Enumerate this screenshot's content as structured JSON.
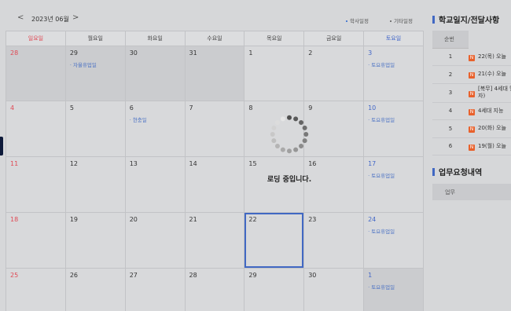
{
  "calendar": {
    "nav_prev": "<",
    "nav_next": ">",
    "month": "2023년 06월",
    "legend_school": "학사일정",
    "legend_other": "기타일정",
    "weekdays": [
      "일요일",
      "월요일",
      "화요일",
      "수요일",
      "목요일",
      "금요일",
      "토요일"
    ],
    "weeks": [
      [
        {
          "day": "28",
          "events": []
        },
        {
          "day": "29",
          "events": [
            "자율휴업일"
          ]
        },
        {
          "day": "30",
          "events": []
        },
        {
          "day": "31",
          "events": []
        },
        {
          "day": "1",
          "events": []
        },
        {
          "day": "2",
          "events": []
        },
        {
          "day": "3",
          "events": [
            "토요휴업일"
          ]
        }
      ],
      [
        {
          "day": "4",
          "events": []
        },
        {
          "day": "5",
          "events": []
        },
        {
          "day": "6",
          "events": [
            "현충일"
          ]
        },
        {
          "day": "7",
          "events": []
        },
        {
          "day": "8",
          "events": []
        },
        {
          "day": "9",
          "events": []
        },
        {
          "day": "10",
          "events": [
            "토요휴업일"
          ]
        }
      ],
      [
        {
          "day": "11",
          "events": []
        },
        {
          "day": "12",
          "events": []
        },
        {
          "day": "13",
          "events": []
        },
        {
          "day": "14",
          "events": []
        },
        {
          "day": "15",
          "events": []
        },
        {
          "day": "16",
          "events": []
        },
        {
          "day": "17",
          "events": [
            "토요휴업일"
          ]
        }
      ],
      [
        {
          "day": "18",
          "events": []
        },
        {
          "day": "19",
          "events": []
        },
        {
          "day": "20",
          "events": []
        },
        {
          "day": "21",
          "events": []
        },
        {
          "day": "22",
          "events": []
        },
        {
          "day": "23",
          "events": []
        },
        {
          "day": "24",
          "events": [
            "토요휴업일"
          ]
        }
      ],
      [
        {
          "day": "25",
          "events": []
        },
        {
          "day": "26",
          "events": []
        },
        {
          "day": "27",
          "events": []
        },
        {
          "day": "28",
          "events": []
        },
        {
          "day": "29",
          "events": []
        },
        {
          "day": "30",
          "events": []
        },
        {
          "day": "1",
          "events": [
            "토요휴업일"
          ]
        }
      ]
    ]
  },
  "loading": {
    "text": "로딩 중입니다."
  },
  "notice": {
    "title": "학교일지/전달사항",
    "col_no": "순번",
    "rows": [
      {
        "no": "1",
        "badge": "N",
        "text": "22(목) 오늘"
      },
      {
        "no": "2",
        "badge": "N",
        "text": "21(수) 오늘"
      },
      {
        "no": "3",
        "badge": "N",
        "text": "[복무] 4세대 당자)"
      },
      {
        "no": "4",
        "badge": "N",
        "text": "4세대 지능"
      },
      {
        "no": "5",
        "badge": "N",
        "text": "20(화) 오늘"
      },
      {
        "no": "6",
        "badge": "N",
        "text": "19(월) 오늘"
      }
    ]
  },
  "request": {
    "title": "업무요청내역",
    "col_task": "업무"
  },
  "colors": {
    "accent": "#4168c3",
    "sunday": "#e04a55",
    "saturday": "#4468c8",
    "badge": "#e8612c"
  }
}
